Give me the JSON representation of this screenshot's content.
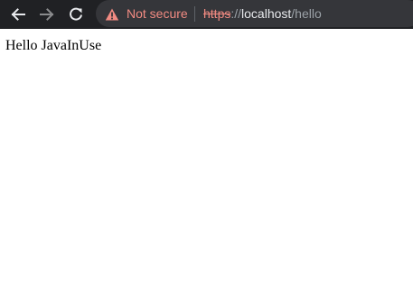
{
  "browser": {
    "security_label": "Not secure",
    "url": {
      "scheme": "https",
      "separator": "://",
      "host": "localhost",
      "path": "/hello"
    },
    "icons": {
      "back": "back-arrow-icon",
      "forward": "forward-arrow-icon",
      "reload": "reload-icon",
      "security": "warning-triangle-icon"
    },
    "forward_enabled": false
  },
  "page": {
    "body_text": "Hello JavaInUse"
  },
  "colors": {
    "toolbar": "#202124",
    "omnibox": "#35363a",
    "warning": "#f28b82",
    "url_host": "#e8eaed",
    "url_dim": "#9aa0a6"
  }
}
